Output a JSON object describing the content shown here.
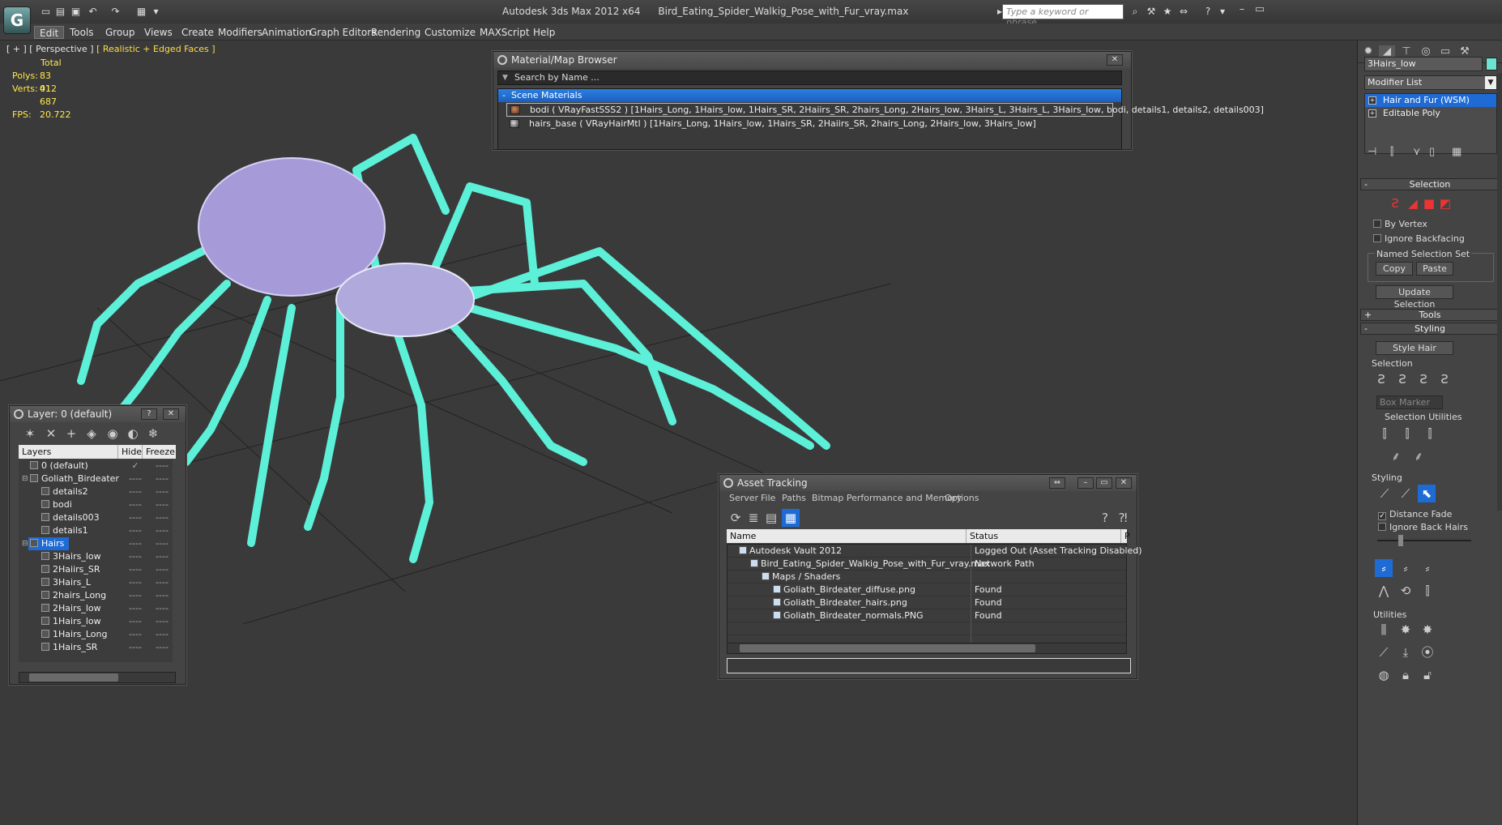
{
  "title": {
    "app": "Autodesk 3ds Max  2012 x64",
    "file": "Bird_Eating_Spider_Walkig_Pose_with_Fur_vray.max",
    "search_placeholder": "Type a keyword or phrase"
  },
  "menu": [
    "Edit",
    "Tools",
    "Group",
    "Views",
    "Create",
    "Modifiers",
    "Animation",
    "Graph Editors",
    "Rendering",
    "Customize",
    "MAXScript",
    "Help"
  ],
  "viewport": {
    "label_plus": "[ + ]",
    "label_view": "[ Perspective ]",
    "label_shading": "[ Realistic + Edged Faces ]",
    "stats": {
      "total_label": "Total",
      "polys_label": "Polys:",
      "polys_value": "83 012",
      "verts_label": "Verts:",
      "verts_value": "41 687",
      "fps_label": "FPS:",
      "fps_value": "20.722"
    }
  },
  "material_browser": {
    "title": "Material/Map Browser",
    "search_placeholder": "Search by Name ...",
    "group": "Scene Materials",
    "group_marker": "-",
    "rows": [
      "bodi  ( VRayFastSSS2 ) [1Hairs_Long, 1Hairs_low, 1Hairs_SR, 2Haiirs_SR, 2hairs_Long, 2Hairs_low, 3Hairs_L, 3Hairs_L, 3Hairs_low, bodi, details1, details2, details003]",
      "hairs_base  ( VRayHairMtl ) [1Hairs_Long, 1Hairs_low, 1Hairs_SR, 2Haiirs_SR, 2hairs_Long, 2Hairs_low, 3Hairs_low]"
    ],
    "close": "✕"
  },
  "layer_dialog": {
    "title": "Layer: 0 (default)",
    "help": "?",
    "close": "✕",
    "columns": {
      "layers": "Layers",
      "hide": "Hide",
      "freeze": "Freeze"
    },
    "rows": [
      {
        "name": "0 (default)",
        "indent": 0,
        "check": "✓",
        "expand": ""
      },
      {
        "name": "Goliath_Birdeater",
        "indent": 0,
        "check": "",
        "expand": "⊟"
      },
      {
        "name": "details2",
        "indent": 1,
        "check": "",
        "expand": ""
      },
      {
        "name": "bodi",
        "indent": 1,
        "check": "",
        "expand": ""
      },
      {
        "name": "details003",
        "indent": 1,
        "check": "",
        "expand": ""
      },
      {
        "name": "details1",
        "indent": 1,
        "check": "",
        "expand": ""
      },
      {
        "name": "Hairs",
        "indent": 0,
        "check": "",
        "expand": "⊟",
        "selected": true
      },
      {
        "name": "3Hairs_low",
        "indent": 1,
        "check": "",
        "expand": ""
      },
      {
        "name": "2Haiirs_SR",
        "indent": 1,
        "check": "",
        "expand": ""
      },
      {
        "name": "3Hairs_L",
        "indent": 1,
        "check": "",
        "expand": ""
      },
      {
        "name": "2hairs_Long",
        "indent": 1,
        "check": "",
        "expand": ""
      },
      {
        "name": "2Hairs_low",
        "indent": 1,
        "check": "",
        "expand": ""
      },
      {
        "name": "1Hairs_low",
        "indent": 1,
        "check": "",
        "expand": ""
      },
      {
        "name": "1Hairs_Long",
        "indent": 1,
        "check": "",
        "expand": ""
      },
      {
        "name": "1Hairs_SR",
        "indent": 1,
        "check": "",
        "expand": ""
      }
    ],
    "dash": "----"
  },
  "asset_tracking": {
    "title": "Asset Tracking",
    "menu": [
      "Server",
      "File",
      "Paths",
      "Bitmap Performance and Memory",
      "Options"
    ],
    "columns": {
      "name": "Name",
      "status": "Status",
      "p": "P"
    },
    "rows": [
      {
        "name": "Autodesk Vault 2012",
        "status": "Logged Out (Asset Tracking Disabled)",
        "indent": 1
      },
      {
        "name": "Bird_Eating_Spider_Walkig_Pose_with_Fur_vray.max",
        "status": "Network Path",
        "indent": 2
      },
      {
        "name": "Maps / Shaders",
        "status": "",
        "indent": 3
      },
      {
        "name": "Goliath_Birdeater_diffuse.png",
        "status": "Found",
        "indent": 4
      },
      {
        "name": "Goliath_Birdeater_hairs.png",
        "status": "Found",
        "indent": 4
      },
      {
        "name": "Goliath_Birdeater_normals.PNG",
        "status": "Found",
        "indent": 4
      }
    ]
  },
  "command_panel": {
    "object_name": "3Hairs_low",
    "object_color": "#6ee2d2",
    "modifier_list": "Modifier List",
    "stack": [
      {
        "label": "Hair and Fur (WSM)",
        "selected": true,
        "box": "+"
      },
      {
        "label": "Editable Poly",
        "selected": false,
        "box": "+"
      }
    ],
    "selection_rollout": "Selection",
    "by_vertex": "By Vertex",
    "ignore_backfacing": "Ignore Backfacing",
    "named_selection_set": "Named Selection Set",
    "copy": "Copy",
    "paste": "Paste",
    "update_selection": "Update Selection",
    "tools_rollout": "Tools",
    "styling_rollout": "Styling",
    "style_hair": "Style Hair",
    "selection_label": "Selection",
    "box_marker": "Box Marker",
    "selection_utilities": "Selection Utilities",
    "styling_label": "Styling",
    "distance_fade": "Distance Fade",
    "ignore_back_hairs": "Ignore Back Hairs",
    "utilities_label": "Utilities",
    "plus": "+",
    "minus": "-"
  }
}
